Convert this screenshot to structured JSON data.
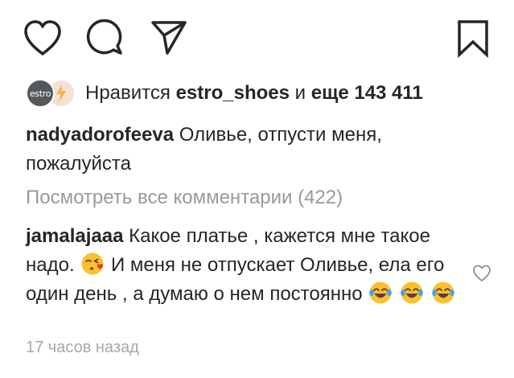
{
  "actions": {
    "like_icon": "heart-icon",
    "comment_icon": "comment-bubble-icon",
    "share_icon": "paper-plane-icon",
    "save_icon": "bookmark-icon"
  },
  "likes": {
    "avatar1_text": "estro",
    "prefix": "Нравится",
    "user": "estro_shoes",
    "connector": "и",
    "more": "еще 143 411"
  },
  "caption": {
    "username": "nadyadorofeeva",
    "text": "Оливье, отпусти меня, пожалуйста"
  },
  "view_all": "Посмотреть все комментарии (422)",
  "comment": {
    "username": "jamalajaaa",
    "text1": "Какое платье , кажется мне такое надо.",
    "text2": "И меня не отпускает Оливье, ела его один день , а думаю о нем постоянно",
    "emoji1": "kissing-face-emoji",
    "emoji2": "tears-of-joy-emoji"
  },
  "timestamp": "17 часов назад",
  "colors": {
    "text": "#262626",
    "secondary": "#999999",
    "timestamp": "#a8a8a8"
  }
}
